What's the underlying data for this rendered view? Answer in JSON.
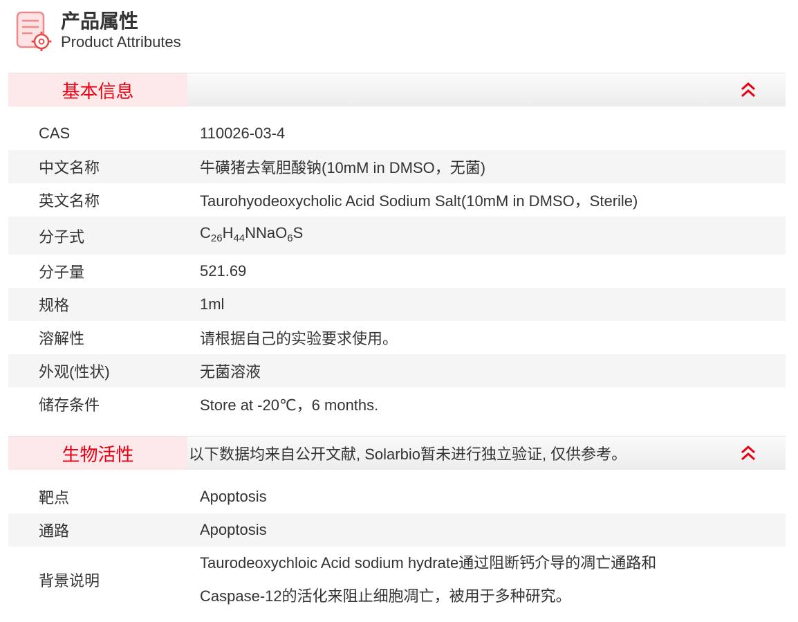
{
  "header": {
    "title_cn": "产品属性",
    "title_en": "Product Attributes",
    "icon": "document-settings-icon"
  },
  "colors": {
    "accent": "#e60012",
    "tab_bg": "#fde8ea",
    "row_alt": "#f5f5f5"
  },
  "basic_info": {
    "tab_label": "基本信息",
    "collapse_icon": "double-chevron-up-icon",
    "rows": [
      {
        "label": "CAS",
        "value": "110026-03-4"
      },
      {
        "label": "中文名称",
        "value": "牛磺猪去氧胆酸钠(10mM in DMSO，无菌)"
      },
      {
        "label": "英文名称",
        "value": "Taurohyodeoxycholic Acid Sodium Salt(10mM in DMSO，Sterile)"
      },
      {
        "label": "分子式",
        "formula": {
          "c": "C",
          "c_sub": "26",
          "h": "H",
          "h_sub": "44",
          "mid": "NNaO",
          "o_sub": "6",
          "end": "S"
        }
      },
      {
        "label": "分子量",
        "value": "521.69"
      },
      {
        "label": "规格",
        "value": "1ml"
      },
      {
        "label": "溶解性",
        "value": "请根据自己的实验要求使用。"
      },
      {
        "label": "外观(性状)",
        "value": "无菌溶液"
      },
      {
        "label": "储存条件",
        "value": "Store at -20℃，6 months."
      }
    ]
  },
  "bio_activity": {
    "tab_label": "生物活性",
    "note": "以下数据均来自公开文献, Solarbio暂未进行独立验证, 仅供参考。",
    "collapse_icon": "double-chevron-up-icon",
    "rows": [
      {
        "label": "靶点",
        "value": "Apoptosis"
      },
      {
        "label": "通路",
        "value": "Apoptosis"
      },
      {
        "label": "背景说明",
        "value_line1": "Taurodeoxychloic Acid sodium hydrate通过阻断钙介导的凋亡通路和",
        "value_line2": "Caspase-12的活化来阻止细胞凋亡，被用于多种研究。"
      }
    ]
  }
}
